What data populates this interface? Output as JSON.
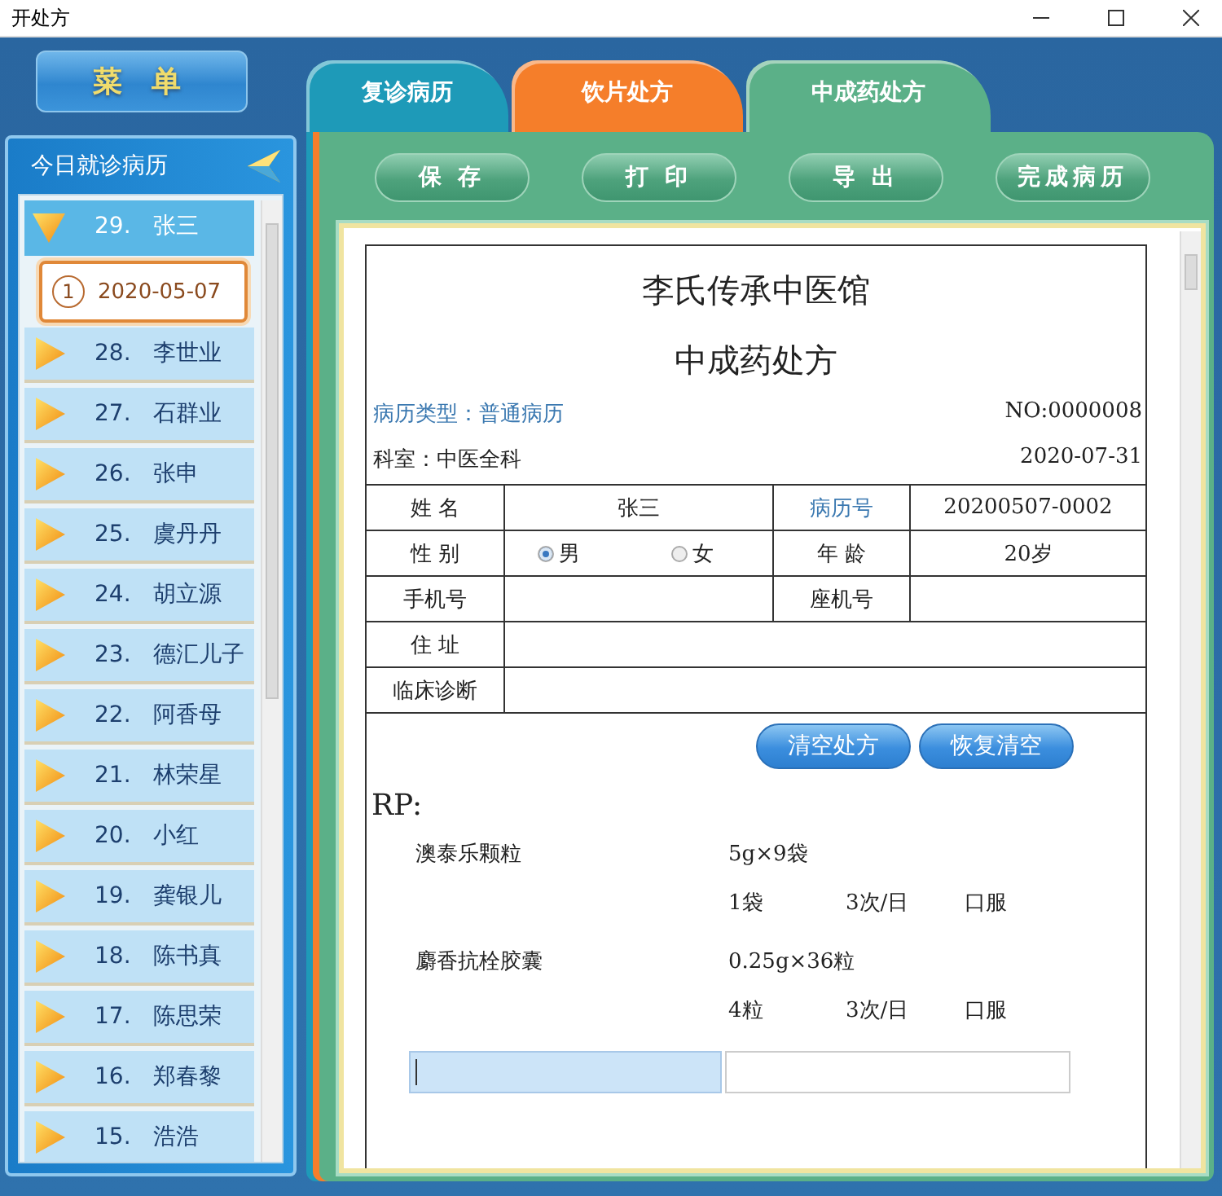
{
  "window": {
    "title": "开处方"
  },
  "menu_button": {
    "label": "菜 单"
  },
  "sidebar": {
    "title": "今日就诊病历",
    "items": [
      {
        "number": "29.",
        "name": "张三",
        "expanded": true,
        "children": [
          {
            "index": "1",
            "date": "2020-05-07",
            "selected": true
          }
        ]
      },
      {
        "number": "28.",
        "name": "李世业",
        "expanded": false
      },
      {
        "number": "27.",
        "name": "石群业",
        "expanded": false
      },
      {
        "number": "26.",
        "name": "张申",
        "expanded": false
      },
      {
        "number": "25.",
        "name": "虞丹丹",
        "expanded": false
      },
      {
        "number": "24.",
        "name": "胡立源",
        "expanded": false
      },
      {
        "number": "23.",
        "name": "德汇儿子",
        "expanded": false
      },
      {
        "number": "22.",
        "name": "阿香母",
        "expanded": false
      },
      {
        "number": "21.",
        "name": "林荣星",
        "expanded": false
      },
      {
        "number": "20.",
        "name": "小红",
        "expanded": false
      },
      {
        "number": "19.",
        "name": "龚银儿",
        "expanded": false
      },
      {
        "number": "18.",
        "name": "陈书真",
        "expanded": false
      },
      {
        "number": "17.",
        "name": "陈思荣",
        "expanded": false
      },
      {
        "number": "16.",
        "name": "郑春黎",
        "expanded": false
      },
      {
        "number": "15.",
        "name": "浩浩",
        "expanded": false
      }
    ]
  },
  "tabs": [
    {
      "label": "复诊病历",
      "selected": false,
      "color": "#1e9ab8"
    },
    {
      "label": "饮片处方",
      "selected": false,
      "color": "#f57e2a"
    },
    {
      "label": "中成药处方",
      "selected": true,
      "color": "#5bb088"
    }
  ],
  "toolbar": {
    "buttons": [
      "保 存",
      "打 印",
      "导 出",
      "完成病历"
    ]
  },
  "prescription": {
    "clinic": "李氏传承中医馆",
    "title": "中成药处方",
    "record_type": "病历类型：普通病历",
    "number": "NO:0000008",
    "department": "科室：中医全科",
    "date": "2020-07-31",
    "table": {
      "rows": [
        [
          {
            "kind": "label",
            "text": "姓 名"
          },
          {
            "kind": "value",
            "text": "张三"
          },
          {
            "kind": "link-label",
            "text": "病历号"
          },
          {
            "kind": "value",
            "text": "20200507-0002"
          }
        ],
        [
          {
            "kind": "label",
            "text": "性 别"
          },
          {
            "kind": "gender",
            "options": [
              {
                "label": "男",
                "selected": true
              },
              {
                "label": "女",
                "selected": false
              }
            ]
          },
          {
            "kind": "label",
            "text": "年 龄"
          },
          {
            "kind": "value",
            "text": "20岁"
          }
        ],
        [
          {
            "kind": "label",
            "text": "手机号"
          },
          {
            "kind": "blank"
          },
          {
            "kind": "label",
            "text": "座机号"
          },
          {
            "kind": "blank"
          }
        ],
        [
          {
            "kind": "label",
            "text": "住 址"
          },
          {
            "kind": "wide-blank"
          }
        ],
        [
          {
            "kind": "label",
            "text": "临床诊断"
          },
          {
            "kind": "wide-blank"
          }
        ]
      ]
    },
    "actions": [
      "清空处方",
      "恢复清空"
    ],
    "rp_label": "RP:",
    "medicines": [
      {
        "name": "澳泰乐颗粒",
        "spec": "5g×9袋",
        "dose": "1袋",
        "frequency": "3次/日",
        "route": "口服"
      },
      {
        "name": "麝香抗栓胶囊",
        "spec": "0.25g×36粒",
        "dose": "4粒",
        "frequency": "3次/日",
        "route": "口服"
      }
    ],
    "entry_fields": [
      {
        "focused": true
      },
      {
        "focused": false
      }
    ]
  }
}
